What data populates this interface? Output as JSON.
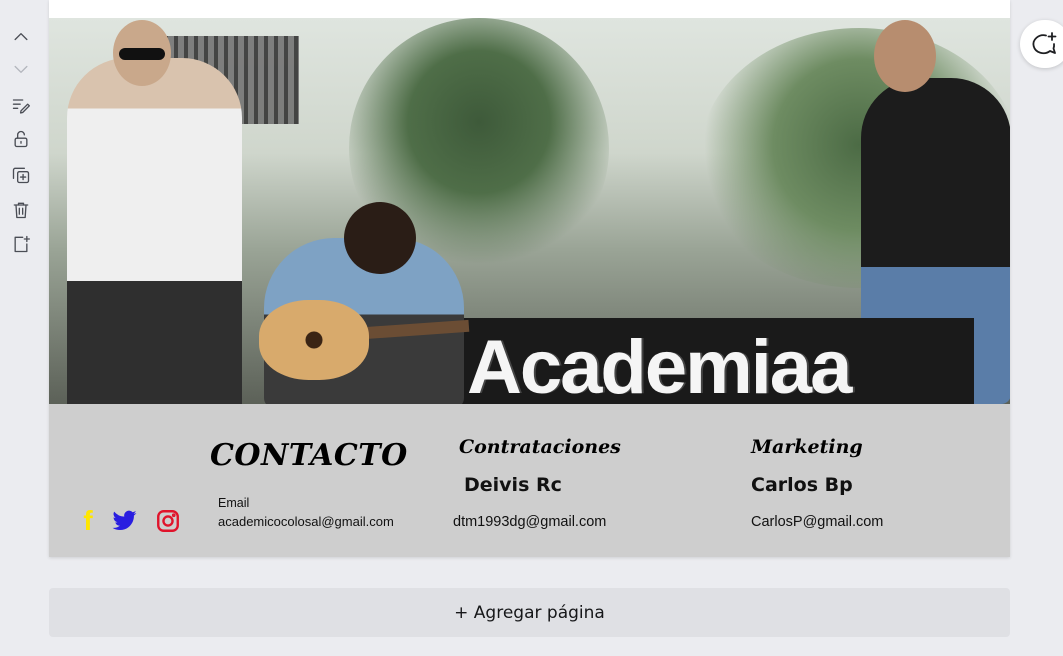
{
  "toolbar": {
    "items": [
      {
        "name": "move-up",
        "icon": "chevron-up-icon"
      },
      {
        "name": "move-down",
        "icon": "chevron-down-icon"
      },
      {
        "name": "add-notes",
        "icon": "notes-pencil-icon"
      },
      {
        "name": "lock",
        "icon": "unlock-icon"
      },
      {
        "name": "duplicate",
        "icon": "duplicate-icon"
      },
      {
        "name": "delete",
        "icon": "trash-icon"
      },
      {
        "name": "add-page",
        "icon": "add-page-icon"
      }
    ]
  },
  "photo": {
    "banner_text": "Academiaa"
  },
  "footer": {
    "contacto_title": "CONTACTO",
    "email_label": "Email",
    "email_value": "academicocolosal@gmail.com",
    "contrataciones": {
      "title": "Contrataciones",
      "name": "Deivis Rc",
      "email": "dtm1993dg@gmail.com"
    },
    "marketing": {
      "title": "Marketing",
      "name": "Carlos Bp",
      "email": "CarlosP@gmail.com"
    },
    "social": {
      "facebook_glyph": "f",
      "facebook_color": "#ffe600",
      "twitter_color": "#2a1ee0",
      "instagram_color": "#e0132b"
    }
  },
  "add_page_label": "+ Agregar página",
  "colors": {
    "background": "#ebecf0",
    "footer_band": "#cecece",
    "add_page_bg": "#dfe0e4"
  }
}
